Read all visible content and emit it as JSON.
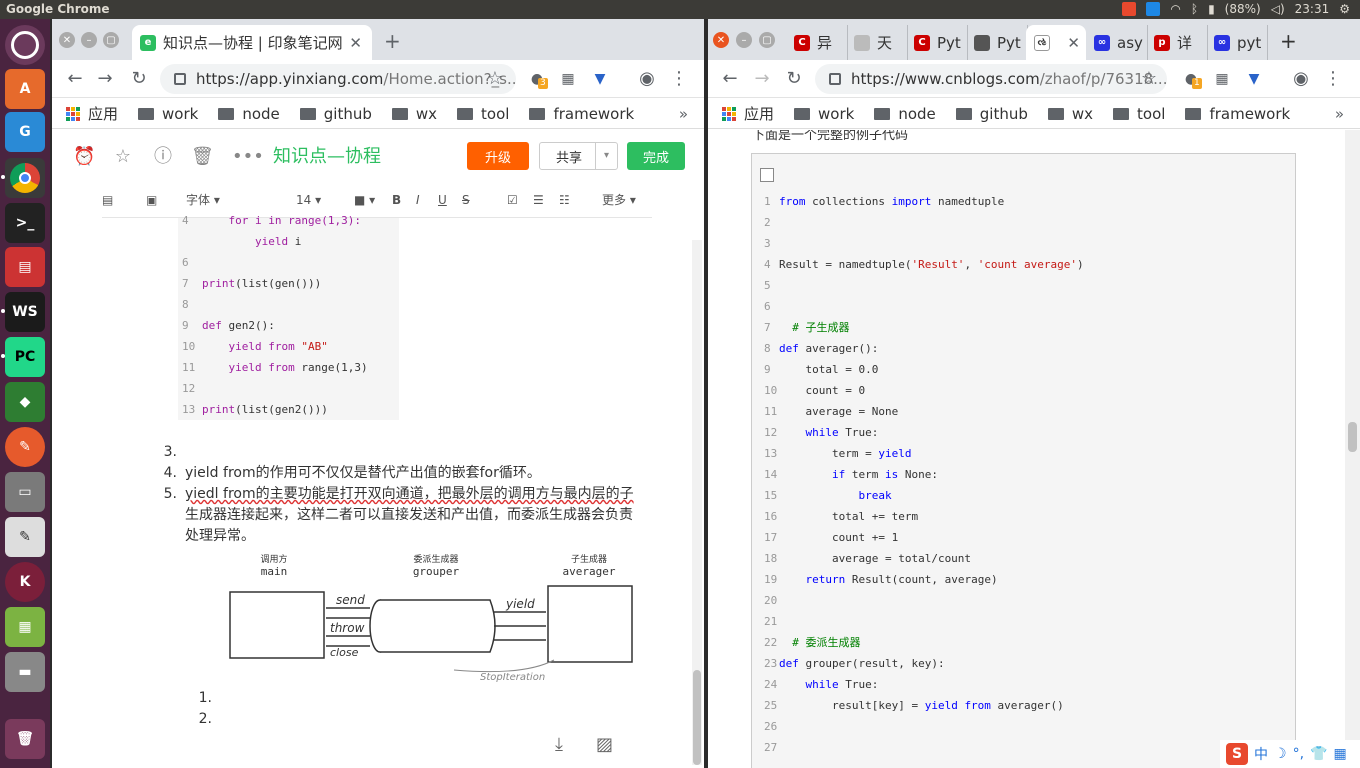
{
  "system": {
    "app_title": "Google Chrome",
    "battery": "(88%)",
    "time": "23:31"
  },
  "left": {
    "tab_title": "知识点—协程 | 印象笔记网",
    "url_main": "https://app.yinxiang.com",
    "url_rest": "/Home.action?_s...",
    "ext_badge": "3",
    "bookmarks": [
      "应用",
      "work",
      "node",
      "github",
      "wx",
      "tool",
      "framework"
    ],
    "note_title": "知识点—协程",
    "upgrade": "升级",
    "share": "共享",
    "done": "完成",
    "fmt": {
      "font": "字体",
      "size": "14",
      "more": "更多"
    },
    "code_lines": [
      {
        "n": "4",
        "t": "    for i in range(1,3):"
      },
      {
        "n": "",
        "t": "        yield i"
      },
      {
        "n": "6",
        "t": ""
      },
      {
        "n": "7",
        "t": "print(list(gen()))"
      },
      {
        "n": "8",
        "t": ""
      },
      {
        "n": "9",
        "t": "def gen2():"
      },
      {
        "n": "10",
        "t": "    yield from \"AB\""
      },
      {
        "n": "11",
        "t": "    yield from range(1,3)"
      },
      {
        "n": "12",
        "t": ""
      },
      {
        "n": "13",
        "t": "print(list(gen2()))"
      }
    ],
    "list_items": [
      {
        "num": "3.",
        "text": ""
      },
      {
        "num": "4.",
        "text": "yield from的作用可不仅仅是替代产出值的嵌套for循环。"
      },
      {
        "num": "5.",
        "text": "yiedl from的主要功能是打开双向通道，把最外层的调用方与最内层的子"
      },
      {
        "num": "",
        "text": "生成器连接起来，这样二者可以直接发送和产出值，而委派生成器会负责"
      },
      {
        "num": "",
        "text": "处理异常。"
      }
    ],
    "diagram": {
      "caller_cn": "调用方",
      "caller": "main",
      "delegate_cn": "委派生成器",
      "delegate": "grouper",
      "sub_cn": "子生成器",
      "sub": "averager",
      "send": "send",
      "throw": "throw",
      "close": "close",
      "yield": "yield",
      "stop": "StopIteration"
    },
    "sub_list": [
      "1.",
      "2."
    ]
  },
  "right": {
    "tabs": [
      "异",
      "天",
      "Pyt",
      "Pyt",
      "",
      "asy",
      "详",
      "pyt"
    ],
    "url_main": "https://www.cnblogs.com",
    "url_rest": "/zhaof/p/76318...",
    "ext_badge": "1",
    "bookmarks": [
      "应用",
      "work",
      "node",
      "github",
      "wx",
      "tool",
      "framework"
    ],
    "head_text": "下面是一个完整的例子代码",
    "code_lines": [
      {
        "n": "1",
        "t": "from collections import namedtuple"
      },
      {
        "n": "2",
        "t": ""
      },
      {
        "n": "3",
        "t": ""
      },
      {
        "n": "4",
        "t": "Result = namedtuple('Result', 'count average')"
      },
      {
        "n": "5",
        "t": ""
      },
      {
        "n": "6",
        "t": ""
      },
      {
        "n": "7",
        "t": "# 子生成器"
      },
      {
        "n": "8",
        "t": "def averager():"
      },
      {
        "n": "9",
        "t": "    total = 0.0"
      },
      {
        "n": "10",
        "t": "    count = 0"
      },
      {
        "n": "11",
        "t": "    average = None"
      },
      {
        "n": "12",
        "t": "    while True:"
      },
      {
        "n": "13",
        "t": "        term = yield"
      },
      {
        "n": "14",
        "t": "        if term is None:"
      },
      {
        "n": "15",
        "t": "            break"
      },
      {
        "n": "16",
        "t": "        total += term"
      },
      {
        "n": "17",
        "t": "        count += 1"
      },
      {
        "n": "18",
        "t": "        average = total/count"
      },
      {
        "n": "19",
        "t": "    return Result(count, average)"
      },
      {
        "n": "20",
        "t": ""
      },
      {
        "n": "21",
        "t": ""
      },
      {
        "n": "22",
        "t": "# 委派生成器"
      },
      {
        "n": "23",
        "t": "def grouper(result, key):"
      },
      {
        "n": "24",
        "t": "    while True:"
      },
      {
        "n": "25",
        "t": "        result[key] = yield from averager()"
      },
      {
        "n": "26",
        "t": ""
      },
      {
        "n": "27",
        "t": ""
      }
    ],
    "ime_label": "中"
  }
}
